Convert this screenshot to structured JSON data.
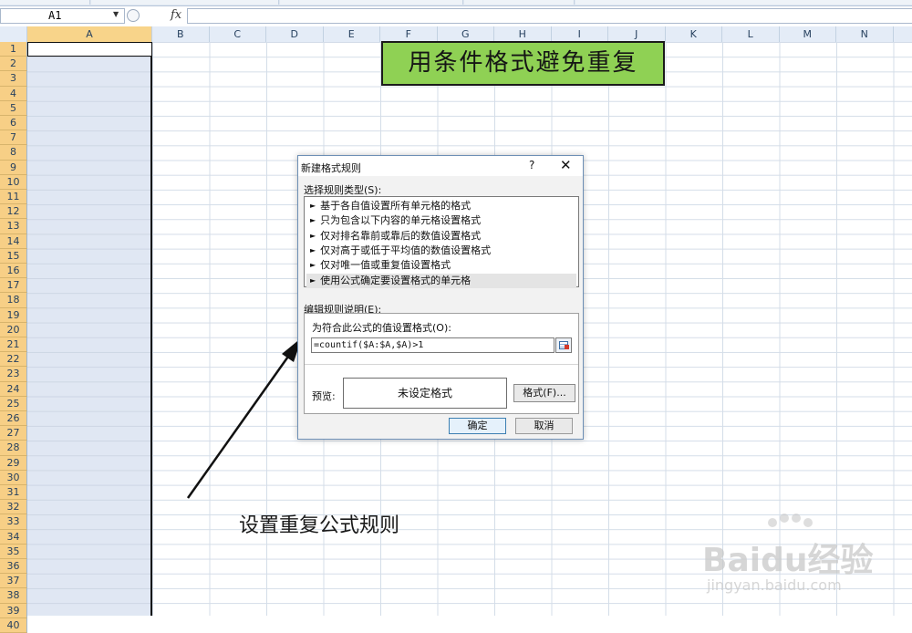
{
  "formula_bar": {
    "name_box": "A1",
    "fx": "fx",
    "formula": ""
  },
  "columns": [
    "A",
    "B",
    "C",
    "D",
    "E",
    "F",
    "G",
    "H",
    "I",
    "J",
    "K",
    "L",
    "M",
    "N"
  ],
  "rows": [
    "1",
    "2",
    "3",
    "4",
    "5",
    "6",
    "7",
    "8",
    "9",
    "10",
    "11",
    "12",
    "13",
    "14",
    "15",
    "16",
    "17",
    "18",
    "19",
    "20",
    "21",
    "22",
    "23",
    "24",
    "25",
    "26",
    "27",
    "28",
    "29",
    "30",
    "31",
    "32",
    "33",
    "34",
    "35",
    "36",
    "37",
    "38",
    "39",
    "40"
  ],
  "banner": {
    "title": "用条件格式避免重复"
  },
  "dialog": {
    "title": "新建格式规则",
    "help": "?",
    "close": "✕",
    "rule_type_label": "选择规则类型(S):",
    "rule_types": [
      "基于各自值设置所有单元格的格式",
      "只为包含以下内容的单元格设置格式",
      "仅对排名靠前或靠后的数值设置格式",
      "仅对高于或低于平均值的数值设置格式",
      "仅对唯一值或重复值设置格式",
      "使用公式确定要设置格式的单元格"
    ],
    "selected_index": 5,
    "desc_label": "编辑规则说明(E):",
    "formula_label": "为符合此公式的值设置格式(O):",
    "formula_value": "=countif($A:$A,$A)>1",
    "preview_label": "预览:",
    "preview_text": "未设定格式",
    "format_button": "格式(F)...",
    "ok_button": "确定",
    "cancel_button": "取消"
  },
  "caption": "设置重复公式规则",
  "watermark": {
    "text": "Baidu经验",
    "sub": "jingyan.baidu.com"
  },
  "colors": {
    "row_header": "#f7cf86",
    "banner": "#8fd154",
    "selected_column": "#e0e7f3"
  }
}
